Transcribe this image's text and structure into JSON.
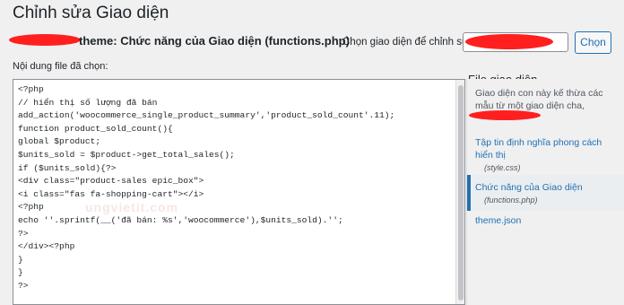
{
  "page": {
    "title": "Chỉnh sửa Giao diện"
  },
  "header": {
    "theme_heading": "theme: Chức năng của Giao diện (functions.php)",
    "select_label": "Chọn giao diện để chỉnh sửa:",
    "choose_button": "Chọn"
  },
  "editor": {
    "label": "Nội dung file đã chọn:",
    "code": "<?php\n// hiển thị số lượng đã bán\nadd_action('woocommerce_single_product_summary','product_sold_count'.11);\nfunction product_sold_count(){\nglobal $product;\n$units_sold = $product->get_total_sales();\nif ($units_sold){?>\n<div class=\"product-sales epic_box\">\n<i class=\"fas fa-shopping-cart\"></i>\n<?php\necho ''.sprintf(__('đã bán: %s','woocommerce'),$units_sold).'';\n?>\n</div><?php\n}\n}\n?>",
    "watermark": "ungvietit.com"
  },
  "sidebar": {
    "title": "File giao diện",
    "inherit_note": "Giao diện con này kế thừa các mẫu từ một giao diện cha,",
    "files": [
      {
        "label": "Tập tin định nghĩa phong cách hiển thị",
        "file": "(style.css)"
      },
      {
        "label": "Chức năng của Giao diện",
        "file": "(functions.php)"
      },
      {
        "label": "theme.json",
        "file": ""
      }
    ]
  },
  "colors": {
    "accent": "#2271b1",
    "redaction": "#ff1f1f",
    "background": "#f0f0f1"
  }
}
